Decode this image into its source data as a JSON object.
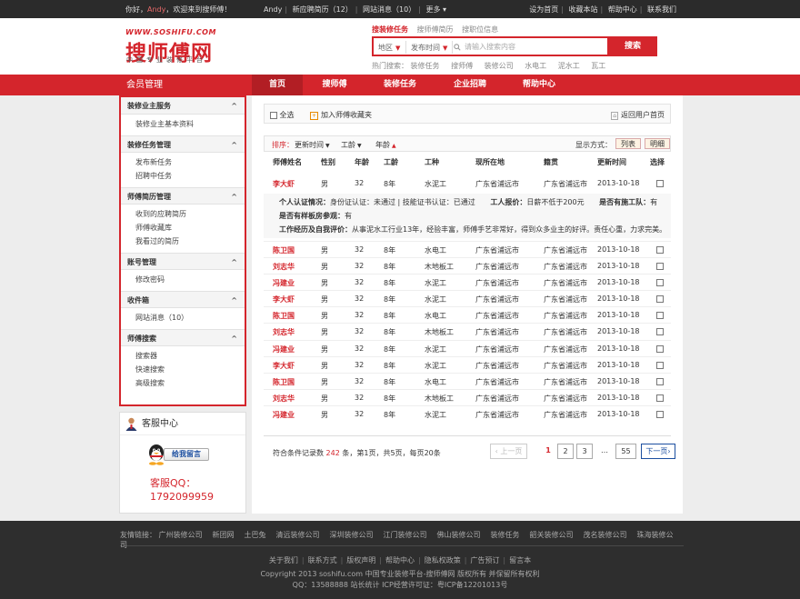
{
  "topbar": {
    "greeting_prefix": "你好，",
    "user_name": "Andy",
    "greeting_suffix": "，欢迎来到搜师傅！",
    "user": "Andy",
    "new_resume": "新应聘简历（12）",
    "site_msg": "网站消息（10）",
    "more": "更多",
    "more_arrow": "▾",
    "links": [
      "设为首页",
      "收藏本站",
      "帮助中心",
      "联系我们"
    ]
  },
  "logo": {
    "url": "WWW.SOSHIFU.COM",
    "name": "搜师傅网",
    "slogan": "中国专业装修平台"
  },
  "search": {
    "tabs": [
      "搜装修任务",
      "搜师傅简历",
      "搜职位信息"
    ],
    "area": "地区",
    "time": "发布时间",
    "arrow": "▼",
    "placeholder": "请输入搜索内容",
    "button": "搜索",
    "hot_label": "热门搜索：",
    "hot": [
      "装修任务",
      "搜师傅",
      "装修公司",
      "水电工",
      "泥水工",
      "瓦工"
    ]
  },
  "nav": {
    "side_title": "会员管理",
    "items": [
      "首页",
      "搜师傅",
      "装修任务",
      "企业招聘",
      "帮助中心"
    ]
  },
  "sidebar": {
    "caret": "^",
    "groups": [
      {
        "title": "装修业主服务",
        "items": [
          "装修业主基本资料"
        ]
      },
      {
        "title": "装修任务管理",
        "items": [
          "发布新任务",
          "招聘中任务"
        ]
      },
      {
        "title": "师傅简历管理",
        "items": [
          "收到的应聘简历",
          "师傅收藏库",
          "我看过的简历"
        ]
      },
      {
        "title": "账号管理",
        "items": [
          "修改密码"
        ]
      },
      {
        "title": "收件箱",
        "items": [
          "网站消息（10）"
        ]
      },
      {
        "title": "师傅搜索",
        "items": [
          "搜索器",
          "快速搜索",
          "高级搜索"
        ]
      }
    ]
  },
  "service": {
    "title": "客服中心",
    "button": "给我留言",
    "qq_label": "客服QQ：",
    "qq": "1792099959"
  },
  "toolbar": {
    "select_all": "全选",
    "add_fav": "加入师傅收藏夹",
    "back": "返回用户首页",
    "plus": "+",
    "home_icon": "⌂"
  },
  "sortbar": {
    "label": "排序：",
    "sorts": [
      "更新时间",
      "工龄",
      "年龄"
    ],
    "down_arrow": "▼",
    "up_arrow": "▲",
    "display_label": "显示方式：",
    "views": [
      "列表",
      "明细"
    ]
  },
  "table": {
    "headers": [
      "师傅姓名",
      "性别",
      "年龄",
      "工龄",
      "工种",
      "现所在地",
      "籍贯",
      "更新时间",
      "选择"
    ],
    "rows": [
      [
        "李大虾",
        "男",
        "32",
        "8年",
        "水泥工",
        "广东省浦远市",
        "广东省浦远市",
        "2013-10-18"
      ],
      [
        "陈卫国",
        "男",
        "32",
        "8年",
        "水电工",
        "广东省浦远市",
        "广东省浦远市",
        "2013-10-18"
      ],
      [
        "刘志华",
        "男",
        "32",
        "8年",
        "木地板工",
        "广东省浦远市",
        "广东省浦远市",
        "2013-10-18"
      ],
      [
        "冯建业",
        "男",
        "32",
        "8年",
        "水泥工",
        "广东省浦远市",
        "广东省浦远市",
        "2013-10-18"
      ],
      [
        "李大虾",
        "男",
        "32",
        "8年",
        "水泥工",
        "广东省浦远市",
        "广东省浦远市",
        "2013-10-18"
      ],
      [
        "陈卫国",
        "男",
        "32",
        "8年",
        "水电工",
        "广东省浦远市",
        "广东省浦远市",
        "2013-10-18"
      ],
      [
        "刘志华",
        "男",
        "32",
        "8年",
        "木地板工",
        "广东省浦远市",
        "广东省浦远市",
        "2013-10-18"
      ],
      [
        "冯建业",
        "男",
        "32",
        "8年",
        "水泥工",
        "广东省浦远市",
        "广东省浦远市",
        "2013-10-18"
      ],
      [
        "李大虾",
        "男",
        "32",
        "8年",
        "水泥工",
        "广东省浦远市",
        "广东省浦远市",
        "2013-10-18"
      ],
      [
        "陈卫国",
        "男",
        "32",
        "8年",
        "水电工",
        "广东省浦远市",
        "广东省浦远市",
        "2013-10-18"
      ],
      [
        "刘志华",
        "男",
        "32",
        "8年",
        "木地板工",
        "广东省浦远市",
        "广东省浦远市",
        "2013-10-18"
      ],
      [
        "冯建业",
        "男",
        "32",
        "8年",
        "水泥工",
        "广东省浦远市",
        "广东省浦远市",
        "2013-10-18"
      ]
    ]
  },
  "detail": {
    "cert_label": "个人认证情况：",
    "cert_value": "身份证认证：未通过 | 技能证书认证：已通过",
    "price_label": "工人报价：",
    "price_value": "日薪不低于200元",
    "team_label": "是否有施工队：",
    "team_value": "有",
    "insurance_label": "是否有样板房参观：",
    "insurance_value": "有",
    "exp_label": "工作经历及自我评价：",
    "exp_value": "从事泥水工行业13年，经验丰富，师傅手艺非常好，得到众多业主的好评。责任心重，力求完美。"
  },
  "pager": {
    "info_prefix": "符合条件记录数",
    "total": "242",
    "info_mid": "条，第1页，共5页，每页",
    "per_page": "20",
    "info_suffix": "条",
    "prev": "上一页",
    "pages": [
      "1",
      "2",
      "3"
    ],
    "dots": "…",
    "last": "55",
    "next": "下一页"
  },
  "footer": {
    "friend_label": "友情链接：",
    "friends": [
      "广州装修公司",
      "新团网",
      "土巴兔",
      "清远装修公司",
      "深圳装修公司",
      "江门装修公司",
      "佛山装修公司",
      "装修任务",
      "韶关装修公司",
      "茂名装修公司",
      "珠海装修公司"
    ],
    "nav": [
      "关于我们",
      "联系方式",
      "版权声明",
      "帮助中心",
      "隐私权政策",
      "广告预订",
      "留言本"
    ],
    "copyright": "Copyright 2013 soshifu.com  中国专业装修平台-搜师傅网 版权所有 并保留所有权利",
    "icp": "QQ：13588888  站长统计  ICP经营许可证：粤ICP备12201013号"
  }
}
